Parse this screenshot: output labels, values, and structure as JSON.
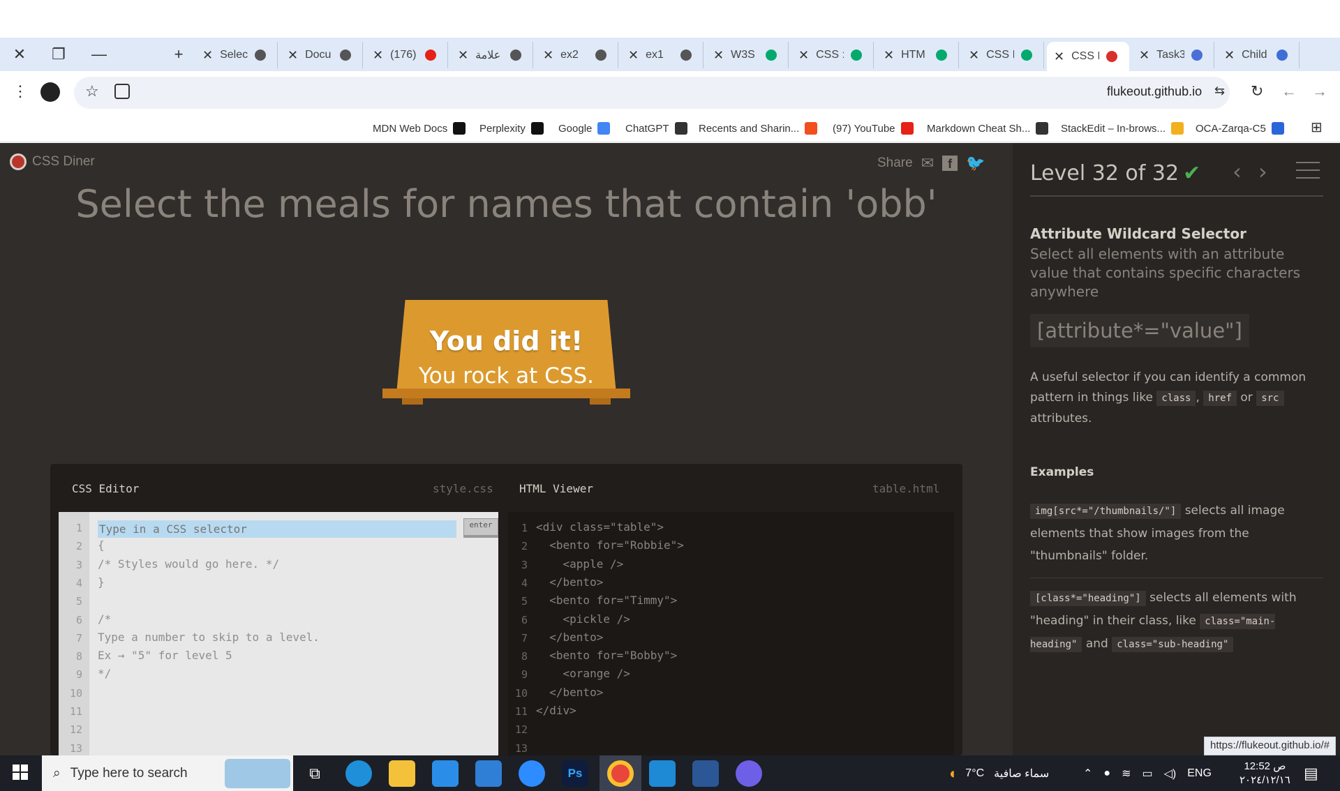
{
  "browser": {
    "tabs": [
      {
        "label": "Selec"
      },
      {
        "label": "Docu"
      },
      {
        "label": "(176)"
      },
      {
        "label": "علامة"
      },
      {
        "label": "ex2"
      },
      {
        "label": "ex1"
      },
      {
        "label": "W3S"
      },
      {
        "label": "CSS :"
      },
      {
        "label": "HTM"
      },
      {
        "label": "CSS I"
      },
      {
        "label": "CSS D",
        "active": true
      },
      {
        "label": "Task3"
      },
      {
        "label": "Child"
      }
    ],
    "address": "flukeout.github.io",
    "bookmarks": [
      "MDN Web Docs",
      "Perplexity",
      "Google",
      "ChatGPT",
      "Recents and Sharin...",
      "(97) YouTube",
      "Markdown Cheat Sh...",
      "StackEdit – In-brows...",
      "OCA-Zarqa-C5"
    ],
    "status_url": "https://flukeout.github.io/#"
  },
  "game": {
    "logo": "CSS Diner",
    "share": "Share",
    "order": "Select the meals for names that contain 'obb'",
    "win_title": "You did it!",
    "win_sub": "You rock at CSS.",
    "css_editor_title": "CSS Editor",
    "css_file": "style.css",
    "html_viewer_title": "HTML Viewer",
    "html_file": "table.html",
    "input_placeholder": "Type in a CSS selector",
    "enter": "enter",
    "css_lines": [
      "",
      "{",
      "/* Styles would go here. */",
      "}",
      "",
      "/*",
      "Type a number to skip to a level.",
      "Ex → \"5\" for level 5",
      "*/",
      "",
      "",
      "",
      ""
    ],
    "html_lines": [
      "<div class=\"table\">",
      "  <bento for=\"Robbie\">",
      "    <apple />",
      "  </bento>",
      "  <bento for=\"Timmy\">",
      "    <pickle />",
      "  </bento>",
      "  <bento for=\"Bobby\">",
      "    <orange />",
      "  </bento>",
      "</div>",
      "",
      ""
    ]
  },
  "sidebar": {
    "level": "Level 32 of 32",
    "title": "Attribute Wildcard Selector",
    "desc": "Select all elements with an attribute value that contains specific characters anywhere",
    "syntax": "[attribute*=\"value\"]",
    "help_pre": "A useful selector if you can identify a common pattern in things like",
    "help_code1": "class",
    "help_comma": ",",
    "help_code2": "href",
    "help_or": "or",
    "help_code3": "src",
    "help_post": "attributes.",
    "examples_title": "Examples",
    "ex1_code": "img[src*=\"/thumbnails/\"]",
    "ex1_text": "selects all image elements that show images from the \"thumbnails\" folder.",
    "ex2_code": "[class*=\"heading\"]",
    "ex2_text": "selects all elements with \"heading\" in their class, like",
    "ex2_code2": "class=\"main-heading\"",
    "ex2_and": "and",
    "ex2_code3": "class=\"sub-heading\""
  },
  "taskbar": {
    "search": "Type here to search",
    "weather": "7°C",
    "weather_desc": "سماء صافية",
    "lang": "ENG",
    "time": "12:52 ص",
    "date": "٢٠٢٤/١٢/١٦"
  }
}
